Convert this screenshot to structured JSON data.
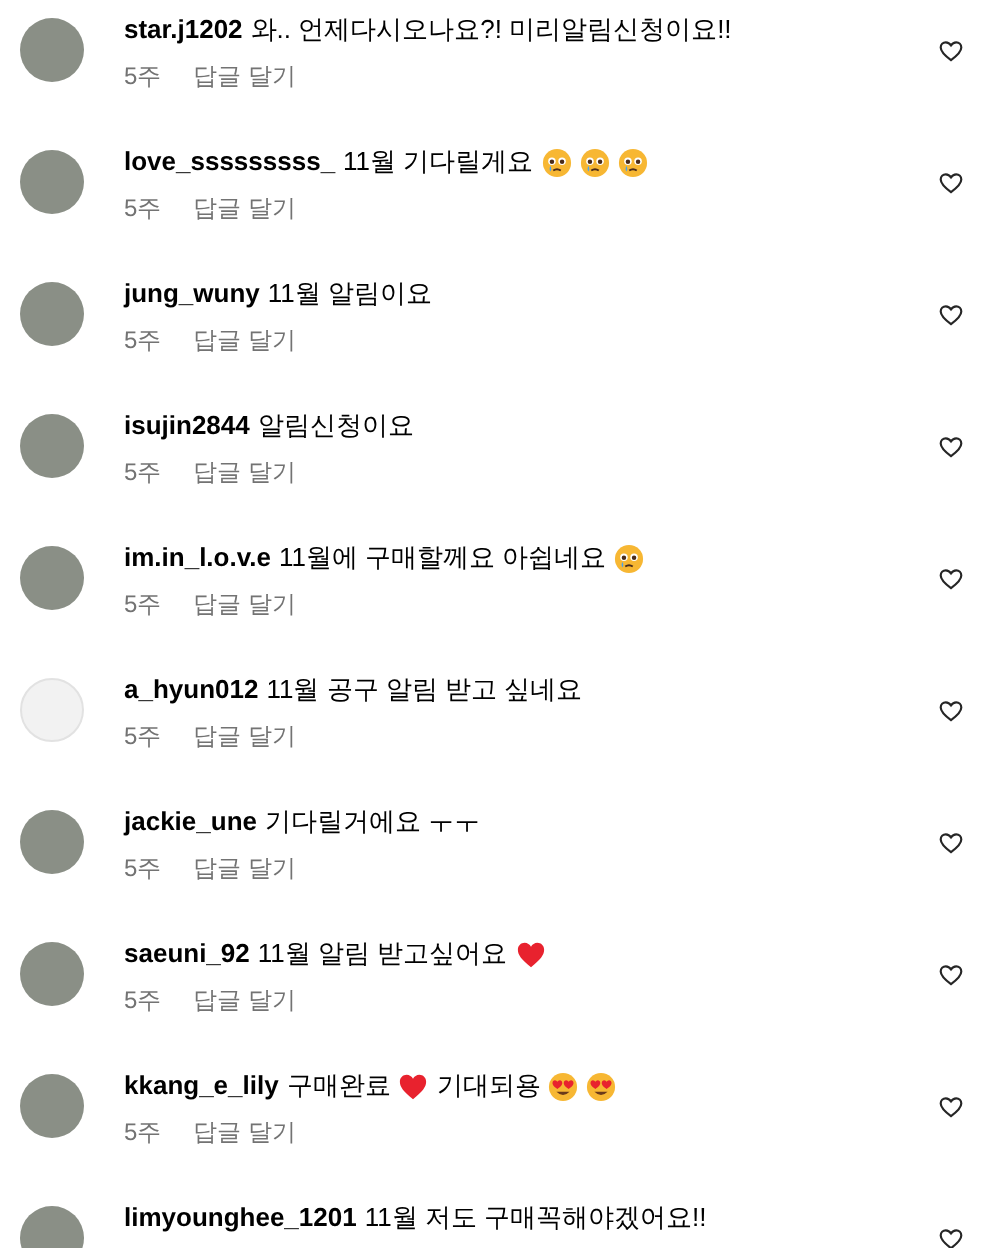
{
  "comments": [
    {
      "username": "star.j1202",
      "has_photo": true,
      "parts": [
        {
          "kind": "text",
          "text": "와.. 언제다시오나요?! 미리알림신청이요!!"
        }
      ],
      "time": "5주",
      "reply": "답글 달기"
    },
    {
      "username": "love_sssssssss_",
      "has_photo": true,
      "parts": [
        {
          "kind": "text",
          "text": "11월 기다릴게요"
        },
        {
          "kind": "teary-face"
        },
        {
          "kind": "teary-face"
        },
        {
          "kind": "teary-face"
        }
      ],
      "time": "5주",
      "reply": "답글 달기"
    },
    {
      "username": "jung_wuny",
      "has_photo": true,
      "parts": [
        {
          "kind": "text",
          "text": "11월 알림이요"
        }
      ],
      "time": "5주",
      "reply": "답글 달기"
    },
    {
      "username": "isujin2844",
      "has_photo": true,
      "parts": [
        {
          "kind": "text",
          "text": "알림신청이요"
        }
      ],
      "time": "5주",
      "reply": "답글 달기"
    },
    {
      "username": "im.in_l.o.v.e",
      "has_photo": true,
      "parts": [
        {
          "kind": "text",
          "text": "11월에 구매할께요 아쉽네요"
        },
        {
          "kind": "teary-face"
        }
      ],
      "time": "5주",
      "reply": "답글 달기"
    },
    {
      "username": "a_hyun012",
      "has_photo": false,
      "parts": [
        {
          "kind": "text",
          "text": "11월 공구 알림 받고 싶네요"
        }
      ],
      "time": "5주",
      "reply": "답글 달기"
    },
    {
      "username": "jackie_une",
      "has_photo": true,
      "parts": [
        {
          "kind": "text",
          "text": "기다릴거에요 ㅜㅜ"
        }
      ],
      "time": "5주",
      "reply": "답글 달기"
    },
    {
      "username": "saeuni_92",
      "has_photo": true,
      "parts": [
        {
          "kind": "text",
          "text": "11월 알림 받고싶어요"
        },
        {
          "kind": "heart"
        }
      ],
      "time": "5주",
      "reply": "답글 달기"
    },
    {
      "username": "kkang_e_lily",
      "has_photo": true,
      "parts": [
        {
          "kind": "text",
          "text": "구매완료"
        },
        {
          "kind": "heart"
        },
        {
          "kind": "text",
          "text": "기대되용"
        },
        {
          "kind": "heart-eyes-face"
        },
        {
          "kind": "heart-eyes-face"
        }
      ],
      "time": "5주",
      "reply": "답글 달기"
    },
    {
      "username": "limyounghee_1201",
      "has_photo": true,
      "parts": [
        {
          "kind": "text",
          "text": "11월 저도 구매꼭해야겠어요!!"
        }
      ]
    }
  ]
}
